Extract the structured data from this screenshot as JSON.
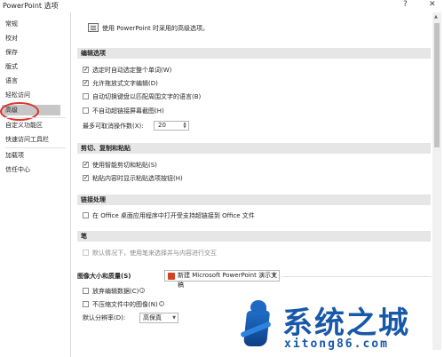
{
  "window": {
    "title": "PowerPoint 选项",
    "help": "?",
    "close": "✕"
  },
  "sidebar": {
    "items": [
      {
        "label": "常规"
      },
      {
        "label": "校对"
      },
      {
        "label": "保存"
      },
      {
        "label": "版式"
      },
      {
        "label": "语言"
      },
      {
        "label": "轻松访问"
      },
      {
        "label": "高级",
        "selected": true
      },
      {
        "label": "自定义功能区"
      },
      {
        "label": "快速访问工具栏"
      },
      {
        "label": "加载项"
      },
      {
        "label": "信任中心"
      }
    ]
  },
  "main": {
    "intro": "使用 PowerPoint 时采用的高级选项。",
    "sections": {
      "editing": {
        "title": "编辑选项",
        "options": [
          {
            "label": "选定时自动选定整个单词(W)",
            "checked": true,
            "enabled": true
          },
          {
            "label": "允许拖放式文字编辑(D)",
            "checked": true,
            "enabled": true
          },
          {
            "label": "自动切换键盘以匹配周围文字的语言(B)",
            "checked": false,
            "enabled": true
          },
          {
            "label": "不自动超链接屏幕截图(H)",
            "checked": false,
            "enabled": true
          }
        ],
        "max_undo_label": "最多可取消操作数(X):",
        "max_undo_value": "20"
      },
      "clipboard": {
        "title": "剪切、复制和粘贴",
        "options": [
          {
            "label": "使用智能剪切和粘贴(S)",
            "checked": true,
            "enabled": true
          },
          {
            "label": "粘贴内容时显示粘贴选项按钮(H)",
            "checked": true,
            "enabled": true
          }
        ]
      },
      "link": {
        "title": "链接处理",
        "options": [
          {
            "label": "在 Office 桌面应用程序中打开受支持超链接到 Office 文件",
            "checked": false,
            "enabled": true
          }
        ]
      },
      "pen": {
        "title": "笔",
        "options": [
          {
            "label": "默认情况下，使用笔来选择并与内容进行交互",
            "checked": false,
            "enabled": false
          }
        ]
      },
      "image": {
        "title": "图像大小和质量(S)",
        "document": "新建 Microsoft PowerPoint 演示文稿",
        "options": [
          {
            "label": "放弃编辑数据(C)",
            "checked": false,
            "enabled": true
          },
          {
            "label": "不压缩文件中的图像(N)",
            "checked": false,
            "enabled": true
          }
        ],
        "resolution_label": "默认分辨率(D):",
        "resolution_value": "高保真"
      }
    }
  },
  "watermark": {
    "title": "系统之城",
    "url": "xitong86.com"
  }
}
